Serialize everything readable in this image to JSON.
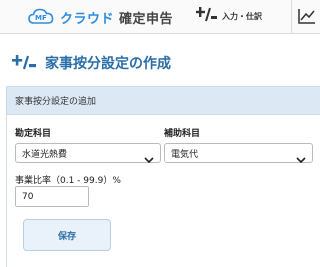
{
  "header": {
    "logo_prefix": "MF",
    "logo_cloud": "クラウド",
    "logo_suffix": "確定申告",
    "nav_entry_label": "入力・仕訳",
    "nav_entry_icon": "plus-slash-icon",
    "nav_chart_icon": "chart-icon"
  },
  "page": {
    "title": "家事按分設定の作成",
    "title_icon": "plus-slash-icon"
  },
  "panel": {
    "heading": "家事按分設定の追加",
    "account_label": "勘定科目",
    "account_value": "水道光熱費",
    "sub_account_label": "補助科目",
    "sub_account_value": "電気代",
    "rate_label": "事業比率（0.1 - 99.9）%",
    "rate_value": "70",
    "save_label": "保存"
  },
  "colors": {
    "brand_blue": "#2e8be0",
    "title_blue": "#2a6ea8",
    "panel_header_bg": "#dce9f5",
    "button_bg": "#e9f1fa"
  }
}
